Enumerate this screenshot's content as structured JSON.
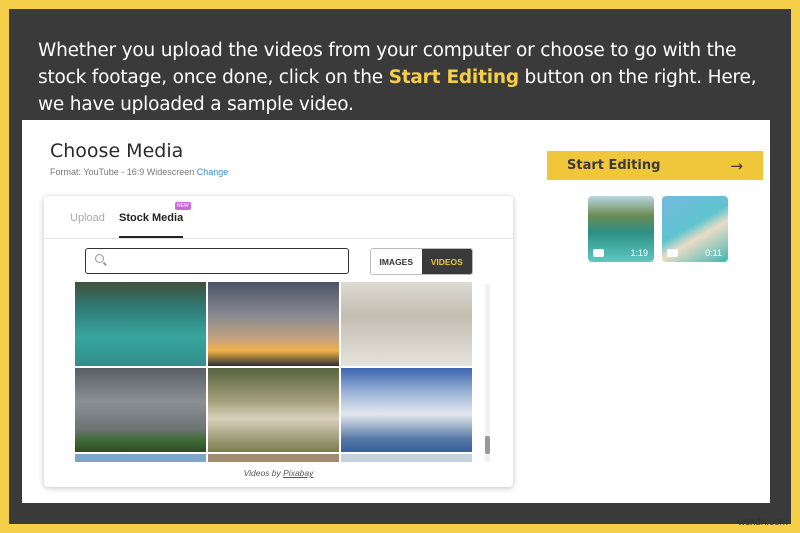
{
  "caption": {
    "before": "Whether you upload the videos from your computer or choose to go with the stock footage, once done, click on the ",
    "highlight": "Start Editing",
    "after": " button on the right. Here, we have uploaded a sample video."
  },
  "app": {
    "title": "Choose Media",
    "format_label": "Format:  YouTube - 16:9 Widescreen ",
    "format_change": "Change",
    "start_button": "Start Editing",
    "arrow_icon": "→",
    "uploaded": [
      {
        "duration": "1:19",
        "icon": "video-camera-icon"
      },
      {
        "duration": "0:11",
        "icon": "video-camera-icon"
      }
    ],
    "tabs": {
      "upload": "Upload",
      "stock": "Stock Media",
      "new_badge": "NEW"
    },
    "search": {
      "placeholder": "",
      "value": ""
    },
    "toggle": {
      "images": "IMAGES",
      "videos": "VIDEOS",
      "selected": "VIDEOS"
    },
    "credit_prefix": "Videos by ",
    "credit_link": "Pixabay"
  },
  "watermark": "wsxdn.com",
  "colors": {
    "accent": "#f0c63a",
    "frame": "#3a3a3a",
    "border": "#f5cf47"
  }
}
